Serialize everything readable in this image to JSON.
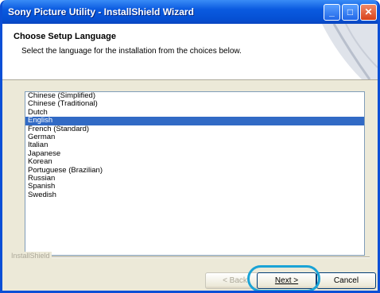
{
  "window": {
    "title": "Sony Picture Utility - InstallShield Wizard"
  },
  "title_buttons": {
    "minimize": "_",
    "maximize": "□",
    "close": "✕"
  },
  "header": {
    "title": "Choose Setup Language",
    "subtitle": "Select the language for the installation from the choices below."
  },
  "languages": [
    "Chinese (Simplified)",
    "Chinese (Traditional)",
    "Dutch",
    "English",
    "French (Standard)",
    "German",
    "Italian",
    "Japanese",
    "Korean",
    "Portuguese (Brazilian)",
    "Russian",
    "Spanish",
    "Swedish"
  ],
  "selected_language": "English",
  "footer": {
    "group_label": "InstallShield"
  },
  "buttons": {
    "back": "< Back",
    "next": "Next >",
    "cancel": "Cancel"
  },
  "colors": {
    "title_bar": "#0a5ae0",
    "selection": "#316ac5",
    "highlight_ring": "#1aa3d6"
  }
}
